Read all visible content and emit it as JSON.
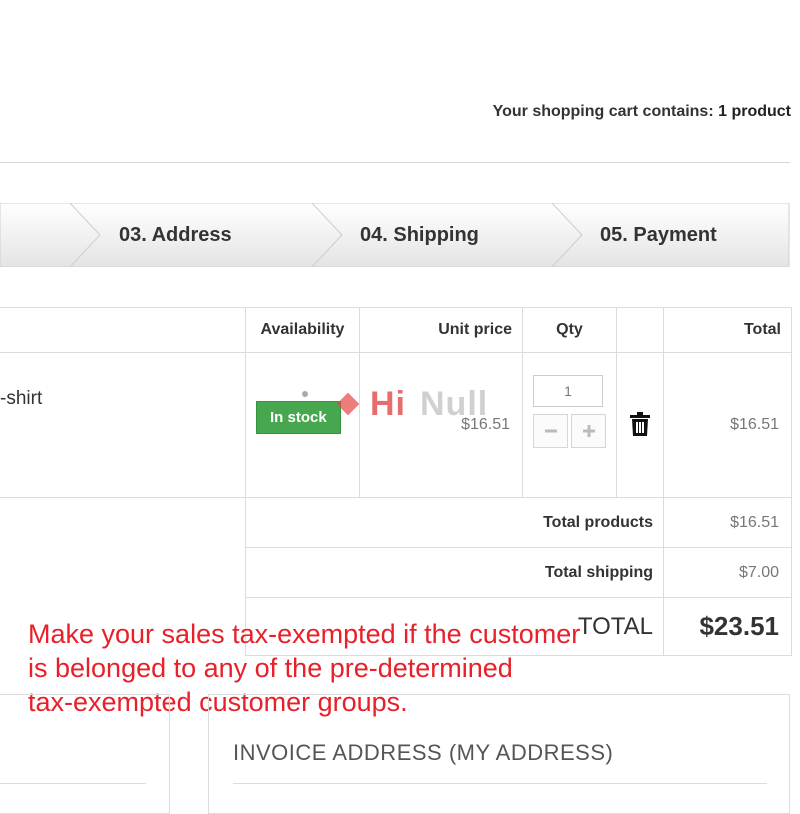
{
  "header": {
    "cart_summary_prefix": "Your shopping cart contains:",
    "cart_summary_count": "1 product"
  },
  "steps": [
    {
      "label": "03. Address"
    },
    {
      "label": "04. Shipping"
    },
    {
      "label": "05. Payment"
    }
  ],
  "table": {
    "columns": {
      "availability": "Availability",
      "unit_price": "Unit price",
      "qty": "Qty",
      "total": "Total"
    },
    "product": {
      "name": "-shirt",
      "availability": "In stock",
      "unit_price": "$16.51",
      "qty": "1",
      "total": "$16.51"
    },
    "summary": {
      "total_products_label": "Total products",
      "total_products_value": "$16.51",
      "total_shipping_label": "Total shipping",
      "total_shipping_value": "$7.00",
      "grand_total_label": "TOTAL",
      "grand_total_value": "$23.51"
    }
  },
  "watermark": {
    "brand_hi": "Hi",
    "brand_null": "Null"
  },
  "annotation": {
    "line1": "Make your sales tax-exempted if the customer",
    "line2": "is belonged to any of the pre-determined",
    "line3": "tax-exempted customer groups."
  },
  "invoice": {
    "title": "INVOICE ADDRESS (MY ADDRESS)"
  },
  "icons": {
    "delete": "trash-icon",
    "increment": "plus-icon",
    "decrement": "minus-icon"
  },
  "colors": {
    "in_stock_badge": "#46a74e",
    "annotation_text": "#e8202a"
  }
}
